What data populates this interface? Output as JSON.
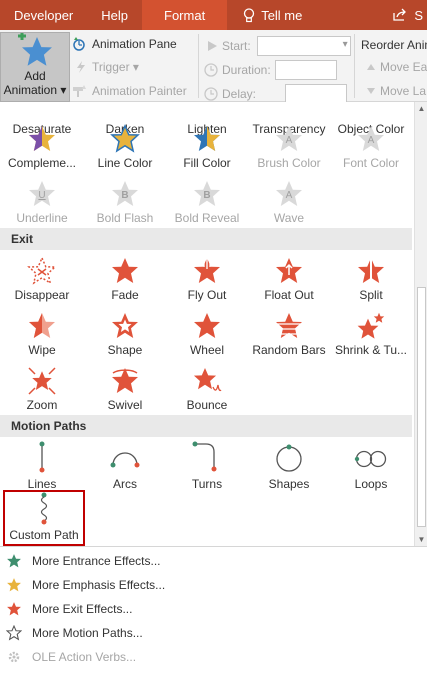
{
  "tabs": {
    "developer": "Developer",
    "help": "Help",
    "format": "Format",
    "tellme": "Tell me",
    "share": "S"
  },
  "ribbon": {
    "add_animation_line1": "Add",
    "add_animation_line2": "Animation ▾",
    "animation_pane": "Animation Pane",
    "trigger": "Trigger ▾",
    "animation_painter": "Animation Painter",
    "start": "Start:",
    "duration": "Duration:",
    "delay": "Delay:",
    "reorder": "Reorder Anim",
    "move_earlier": "Move Ea",
    "move_later": "Move La"
  },
  "gallery": {
    "partial_row": [
      "Desaturate",
      "Darken",
      "Lighten",
      "Transparency",
      "Object Color"
    ],
    "emphasis_row1": [
      "Compleme...",
      "Line Color",
      "Fill Color",
      "Brush Color",
      "Font Color"
    ],
    "emphasis_row2": [
      "Underline",
      "Bold Flash",
      "Bold Reveal",
      "Wave"
    ],
    "exit_header": "Exit",
    "exit_row1": [
      "Disappear",
      "Fade",
      "Fly Out",
      "Float Out",
      "Split"
    ],
    "exit_row2": [
      "Wipe",
      "Shape",
      "Wheel",
      "Random Bars",
      "Shrink & Tu..."
    ],
    "exit_row3": [
      "Zoom",
      "Swivel",
      "Bounce"
    ],
    "motion_header": "Motion Paths",
    "motion_row1": [
      "Lines",
      "Arcs",
      "Turns",
      "Shapes",
      "Loops"
    ],
    "motion_row2": [
      "Custom Path"
    ]
  },
  "menu": {
    "entrance": "More Entrance Effects...",
    "emphasis": "More Emphasis Effects...",
    "exit": "More Exit Effects...",
    "motion": "More Motion Paths...",
    "ole": "OLE Action Verbs..."
  },
  "colors": {
    "tabbar": "#b7472a",
    "tab_active": "#d35230",
    "exit_red": "#e0533a",
    "entrance_green": "#3e8e6e",
    "emphasis_gold": "#e8b33c",
    "selection": "#c00000"
  }
}
